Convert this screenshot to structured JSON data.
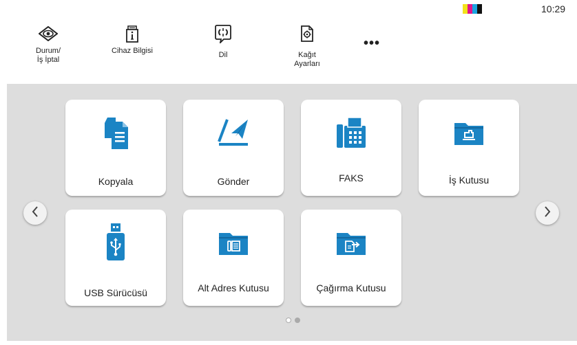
{
  "status": {
    "time": "10:29",
    "toner_colors": [
      "#f2e21a",
      "#e0178b",
      "#1aa3e0",
      "#111111"
    ]
  },
  "toolbar": {
    "status_cancel_label": "Durum/\nİş İptal",
    "device_info_label": "Cihaz Bilgisi",
    "language_label": "Dil",
    "paper_settings_label": "Kağıt\nAyarları",
    "more_label": "•••"
  },
  "apps": [
    {
      "label": "Kopyala",
      "icon": "copy-icon"
    },
    {
      "label": "Gönder",
      "icon": "send-icon"
    },
    {
      "label": "FAKS",
      "icon": "fax-icon"
    },
    {
      "label": "İş Kutusu",
      "icon": "job-box-icon"
    },
    {
      "label": "USB Sürücüsü",
      "icon": "usb-drive-icon"
    },
    {
      "label": "Alt Adres Kutusu",
      "icon": "sub-address-box-icon"
    },
    {
      "label": "Çağırma Kutusu",
      "icon": "polling-box-icon"
    }
  ],
  "pagination": {
    "pages": 2,
    "current": 2
  },
  "colors": {
    "accent": "#1b84c4",
    "background": "#dddddd"
  }
}
